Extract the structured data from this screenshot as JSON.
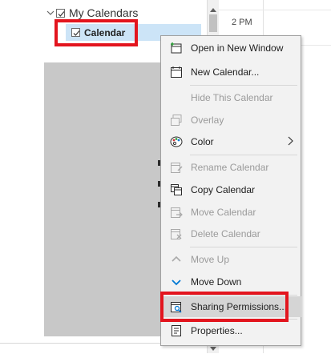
{
  "nav": {
    "group_label": "My Calendars",
    "calendar_label": "Calendar"
  },
  "day_view": {
    "time_label": "2 PM"
  },
  "context_menu": {
    "items": [
      {
        "label": "Open in New Window",
        "enabled": true,
        "icon": "open-window-icon"
      },
      {
        "label": "New Calendar...",
        "enabled": true,
        "icon": "new-calendar-icon"
      },
      {
        "label": "Hide This Calendar",
        "enabled": false,
        "icon": ""
      },
      {
        "label": "Overlay",
        "enabled": false,
        "icon": "overlay-icon"
      },
      {
        "label": "Color",
        "enabled": true,
        "icon": "palette-icon",
        "submenu": true
      },
      {
        "label": "Rename Calendar",
        "enabled": false,
        "icon": "rename-icon"
      },
      {
        "label": "Copy Calendar",
        "enabled": true,
        "icon": "copy-calendar-icon"
      },
      {
        "label": "Move Calendar",
        "enabled": false,
        "icon": "move-calendar-icon"
      },
      {
        "label": "Delete Calendar",
        "enabled": false,
        "icon": "delete-calendar-icon"
      },
      {
        "label": "Move Up",
        "enabled": false,
        "icon": "arrow-up-icon"
      },
      {
        "label": "Move Down",
        "enabled": true,
        "icon": "arrow-down-icon"
      },
      {
        "label": "Sharing Permissions...",
        "enabled": true,
        "icon": "sharing-permissions-icon",
        "hovered": true
      },
      {
        "label": "Properties...",
        "enabled": true,
        "icon": "properties-icon"
      }
    ]
  },
  "colors": {
    "highlight_red": "#e3151e",
    "selection_blue": "#cce4f7",
    "accent_blue": "#0078d4"
  }
}
